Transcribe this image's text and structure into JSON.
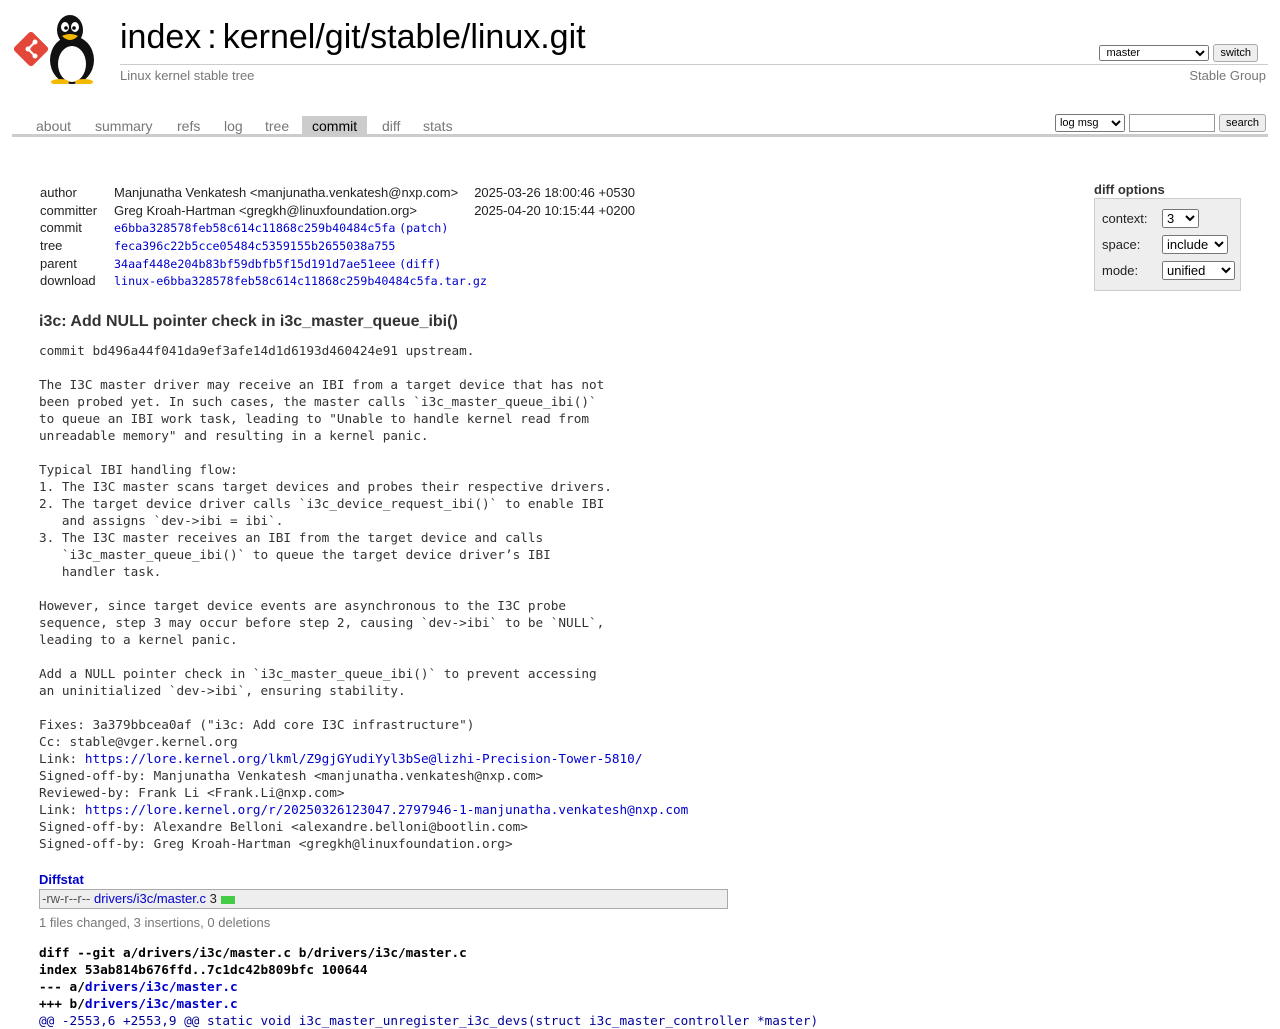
{
  "header": {
    "title_index": "index",
    "title_sep": ":",
    "title_repo": "kernel/git/stable/linux.git",
    "description": "Linux kernel stable tree",
    "owner": "Stable Group",
    "branch_selected": "master",
    "switch_label": "switch"
  },
  "tabs": [
    {
      "label": "about"
    },
    {
      "label": "summary"
    },
    {
      "label": "refs"
    },
    {
      "label": "log"
    },
    {
      "label": "tree"
    },
    {
      "label": "commit",
      "active": true
    },
    {
      "label": "diff"
    },
    {
      "label": "stats"
    }
  ],
  "search": {
    "mode": "log msg",
    "value": "",
    "button": "search"
  },
  "commit_info": {
    "author_label": "author",
    "author": "Manjunatha Venkatesh <manjunatha.venkatesh@nxp.com>",
    "author_date": "2025-03-26 18:00:46 +0530",
    "committer_label": "committer",
    "committer": "Greg Kroah-Hartman <gregkh@linuxfoundation.org>",
    "committer_date": "2025-04-20 10:15:44 +0200",
    "commit_label": "commit",
    "commit": "e6bba328578feb58c614c11868c259b40484c5fa",
    "patch_link": "patch",
    "tree_label": "tree",
    "tree": "feca396c22b5cce05484c5359155b2655038a755",
    "parent_label": "parent",
    "parent": "34aaf448e204b83bf59dbfb5f15d191d7ae51eee",
    "diff_link": "diff",
    "download_label": "download",
    "download": "linux-e6bba328578feb58c614c11868c259b40484c5fa.tar.gz"
  },
  "diff_options": {
    "title": "diff options",
    "context_label": "context:",
    "context_value": "3",
    "space_label": "space:",
    "space_value": "include",
    "mode_label": "mode:",
    "mode_value": "unified"
  },
  "subject": "i3c: Add NULL pointer check in i3c_master_queue_ibi()",
  "message": {
    "before_link1": "commit bd496a44f041da9ef3afe14d1d6193d460424e91 upstream.\n\nThe I3C master driver may receive an IBI from a target device that has not\nbeen probed yet. In such cases, the master calls `i3c_master_queue_ibi()`\nto queue an IBI work task, leading to \"Unable to handle kernel read from\nunreadable memory\" and resulting in a kernel panic.\n\nTypical IBI handling flow:\n1. The I3C master scans target devices and probes their respective drivers.\n2. The target device driver calls `i3c_device_request_ibi()` to enable IBI\n   and assigns `dev->ibi = ibi`.\n3. The I3C master receives an IBI from the target device and calls\n   `i3c_master_queue_ibi()` to queue the target device driver’s IBI\n   handler task.\n\nHowever, since target device events are asynchronous to the I3C probe\nsequence, step 3 may occur before step 2, causing `dev->ibi` to be `NULL`,\nleading to a kernel panic.\n\nAdd a NULL pointer check in `i3c_master_queue_ibi()` to prevent accessing\nan uninitialized `dev->ibi`, ensuring stability.\n\nFixes: 3a379bbcea0af (\"i3c: Add core I3C infrastructure\")\nCc: stable@vger.kernel.org\nLink: ",
    "link1": "https://lore.kernel.org/lkml/Z9gjGYudiYyl3bSe@lizhi-Precision-Tower-5810/",
    "between_links": "\nSigned-off-by: Manjunatha Venkatesh <manjunatha.venkatesh@nxp.com>\nReviewed-by: Frank Li <Frank.Li@nxp.com>\nLink: ",
    "link2": "https://lore.kernel.org/r/20250326123047.2797946-1-manjunatha.venkatesh@nxp.com",
    "after_link2": "\nSigned-off-by: Alexandre Belloni <alexandre.belloni@bootlin.com>\nSigned-off-by: Greg Kroah-Hartman <gregkh@linuxfoundation.org>"
  },
  "diffstat": {
    "heading": "Diffstat",
    "mode": "-rw-r--r--",
    "file": "drivers/i3c/master.c",
    "changes": "3",
    "bar_color": "#44cc44",
    "summary": "1 files changed, 3 insertions, 0 deletions"
  },
  "diff": {
    "line1": "diff --git a/drivers/i3c/master.c b/drivers/i3c/master.c",
    "line2": "index 53ab814b676ffd..7c1dc42b809bfc 100644",
    "line3_prefix": "--- a/",
    "line3_file": "drivers/i3c/master.c",
    "line4_prefix": "+++ b/",
    "line4_file": "drivers/i3c/master.c",
    "hunk": "@@ -2553,6 +2553,9 @@ static void i3c_master_unregister_i3c_devs(struct i3c_master_controller *master)"
  },
  "colors": {
    "link": "#0000cc",
    "tab_active_bg": "#cccccc",
    "muted": "#777777"
  }
}
